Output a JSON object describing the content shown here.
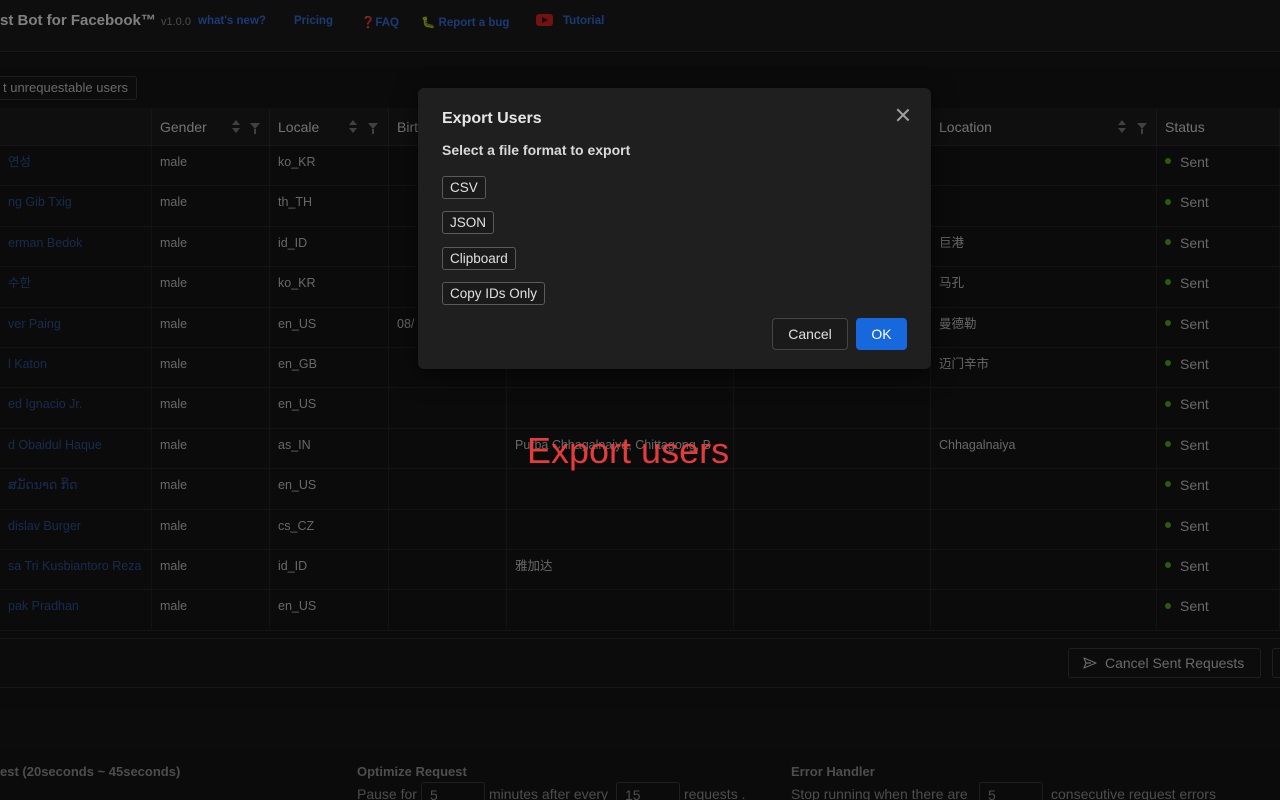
{
  "header": {
    "title": "st Bot for Facebook™",
    "version": "v1.0.0",
    "whats_new": "what's new?",
    "pricing": "Pricing",
    "faq": "❓FAQ",
    "report_bug": "🐛 Report a bug",
    "tutorial": "Tutorial"
  },
  "toolbar": {
    "unrequestable_button": "t unrequestable users"
  },
  "table": {
    "columns": {
      "gender": "Gender",
      "locale": "Locale",
      "birthday": "Birt",
      "location": "Location",
      "status": "Status"
    },
    "rows": [
      {
        "name": "연성",
        "gender": "male",
        "locale": "ko_KR",
        "birthday": "",
        "hometown": "",
        "location": "",
        "status": "Sent"
      },
      {
        "name": "ng Gib Txig",
        "gender": "male",
        "locale": "th_TH",
        "birthday": "",
        "hometown": "",
        "location": "",
        "status": "Sent"
      },
      {
        "name": "erman Bedok",
        "gender": "male",
        "locale": "id_ID",
        "birthday": "",
        "hometown": "",
        "location": "巨港",
        "status": "Sent"
      },
      {
        "name": "수한",
        "gender": "male",
        "locale": "ko_KR",
        "birthday": "",
        "hometown": "",
        "location": "马孔",
        "status": "Sent"
      },
      {
        "name": "ver Paing",
        "gender": "male",
        "locale": "en_US",
        "birthday": "08/",
        "hometown": "",
        "location": "曼德勒",
        "status": "Sent"
      },
      {
        "name": "l Katon",
        "gender": "male",
        "locale": "en_GB",
        "birthday": "",
        "hometown": "",
        "location": "迈门辛市",
        "status": "Sent"
      },
      {
        "name": "ed Ignacio Jr.",
        "gender": "male",
        "locale": "en_US",
        "birthday": "",
        "hometown": "",
        "location": "",
        "status": "Sent"
      },
      {
        "name": "d Obaidul Haque",
        "gender": "male",
        "locale": "as_IN",
        "birthday": "",
        "hometown": "Purba Chhagalnaiya, Chittagong, B",
        "location": "Chhagalnaiya",
        "status": "Sent"
      },
      {
        "name": "ສມັດນາດ ກິດ",
        "gender": "male",
        "locale": "en_US",
        "birthday": "",
        "hometown": "",
        "location": "",
        "status": "Sent"
      },
      {
        "name": "dislav Burger",
        "gender": "male",
        "locale": "cs_CZ",
        "birthday": "",
        "hometown": "",
        "location": "",
        "status": "Sent"
      },
      {
        "name": "sa Tri Kusbiantoro Reza",
        "gender": "male",
        "locale": "id_ID",
        "birthday": "",
        "hometown": "雅加达",
        "location": "",
        "status": "Sent"
      },
      {
        "name": "pak Pradhan",
        "gender": "male",
        "locale": "en_US",
        "birthday": "",
        "hometown": "",
        "location": "",
        "status": "Sent"
      }
    ]
  },
  "footer": {
    "cancel_sent_requests": "Cancel Sent Requests"
  },
  "settings": {
    "interval_heading": "est (20seconds ~ 45seconds)",
    "optimize_heading": "Optimize Request",
    "optimize_pause": "Pause for",
    "optimize_pause_value": "5",
    "optimize_minutes": "minutes after every",
    "optimize_every_value": "15",
    "optimize_requests": "requests .",
    "error_heading": "Error Handler",
    "error_text": "Stop running when there are",
    "error_value": "5",
    "error_suffix": "consecutive request errors"
  },
  "modal": {
    "title": "Export Users",
    "subtitle": "Select a file format to export",
    "formats": [
      "CSV",
      "JSON",
      "Clipboard",
      "Copy IDs Only"
    ],
    "cancel": "Cancel",
    "ok": "OK"
  },
  "annotation": {
    "caption": "Export users"
  },
  "colors": {
    "accent": "#1668dc",
    "link": "#2f6bd6",
    "status_sent": "#49aa19",
    "caption": "#e53b3b"
  },
  "icons": {
    "close": "close-icon",
    "send": "send-icon",
    "youtube": "youtube-icon"
  }
}
